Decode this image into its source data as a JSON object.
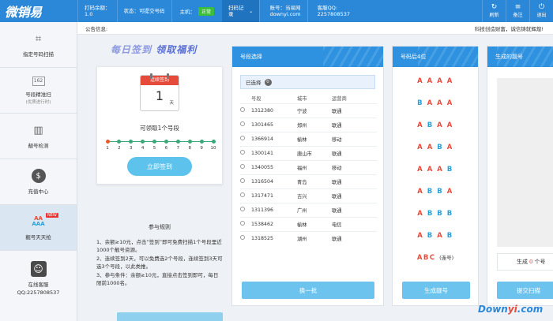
{
  "app": {
    "logo": "微销易"
  },
  "topbar": {
    "balance_label": "打码余额：",
    "balance_value": "1.0",
    "status_label": "状态：",
    "status_value": "可提交号码",
    "host_label": "主机：",
    "host_value": "正常",
    "sign_record": "扫码记录",
    "account_label": "账号：当易网",
    "account_value": "downyi.com",
    "qq_label": "客服QQ:",
    "qq_value": "2257808537",
    "refresh": "刷新",
    "notes": "备注",
    "logout": "退出"
  },
  "sidebar": {
    "items": [
      {
        "label": "指定号码扫描",
        "sub": "",
        "icon": "scan-icon"
      },
      {
        "label": "号段精准扫",
        "sub": "(优质进行时)",
        "icon": "number-segment-icon"
      },
      {
        "label": "靓号检测",
        "sub": "",
        "icon": "building-icon"
      },
      {
        "label": "充值中心",
        "sub": "",
        "icon": "money-bag-icon"
      },
      {
        "label": "靓号天天抢",
        "sub": "",
        "icon": "aaa-icon",
        "tag": "NEW"
      }
    ],
    "service_label": "在线客服",
    "service_qq": "QQ:2257808537"
  },
  "notice": {
    "label": "公告信息:",
    "text": "科技创造财富，诚信铸就辉煌!"
  },
  "signin": {
    "slogan_a": "每日签到",
    "slogan_b": "领取福利",
    "cal_header": "连续签到",
    "cal_day": "1",
    "cal_unit": "天",
    "can_take": "可领取1个号段",
    "steps": [
      "1",
      "2",
      "3",
      "4",
      "5",
      "6",
      "7",
      "8",
      "9",
      "10"
    ],
    "button": "立即签到"
  },
  "rules": {
    "title": "参与规则",
    "r1": "1、余额≥10元，点击“签到”即可免费扫描1个号段里近1000个靓号资源。",
    "r2": "2、连续签到2天，可以免费选2个号段，连续签到3天可选3个号段，以此类推。",
    "r3": "3、参与条件：余额≥10元，直接点击签到即可，每日限前1000名。"
  },
  "segment": {
    "title": "号段选择",
    "selected_label": "已选择",
    "selected_count": "0",
    "headers": [
      "号段",
      "城市",
      "运营商"
    ],
    "rows": [
      [
        "1312380",
        "宁波",
        "联通"
      ],
      [
        "1301465",
        "郑州",
        "联通"
      ],
      [
        "1366914",
        "榆林",
        "移动"
      ],
      [
        "1300141",
        "唐山市",
        "联通"
      ],
      [
        "1340055",
        "福州",
        "移动"
      ],
      [
        "1316504",
        "青岛",
        "联通"
      ],
      [
        "1317471",
        "吉兴",
        "联通"
      ],
      [
        "1311396",
        "广州",
        "联通"
      ],
      [
        "1538462",
        "榆林",
        "电信"
      ],
      [
        "1318525",
        "湖州",
        "联通"
      ]
    ],
    "button": "换一批"
  },
  "patterns": {
    "title": "号码后4位",
    "button": "生成靓号",
    "items": [
      "AAAA",
      "BAAA",
      "ABAA",
      "AABA",
      "AAAB",
      "ABBA",
      "ABBB",
      "ABAB"
    ],
    "abc": "ABC",
    "abc_note": "(连号)"
  },
  "generated": {
    "title": "生成的靓号",
    "gen_prefix": "生成",
    "gen_count": "0",
    "gen_suffix": "个号",
    "button": "提交扫描"
  },
  "watermark": {
    "a": "Down",
    "b": "yi",
    "c": ".com"
  },
  "colors": {
    "primary": "#2b88d8",
    "button": "#6cc3ee",
    "red": "#e84b3c",
    "blue": "#2aa0d8",
    "green": "#3aa776"
  }
}
